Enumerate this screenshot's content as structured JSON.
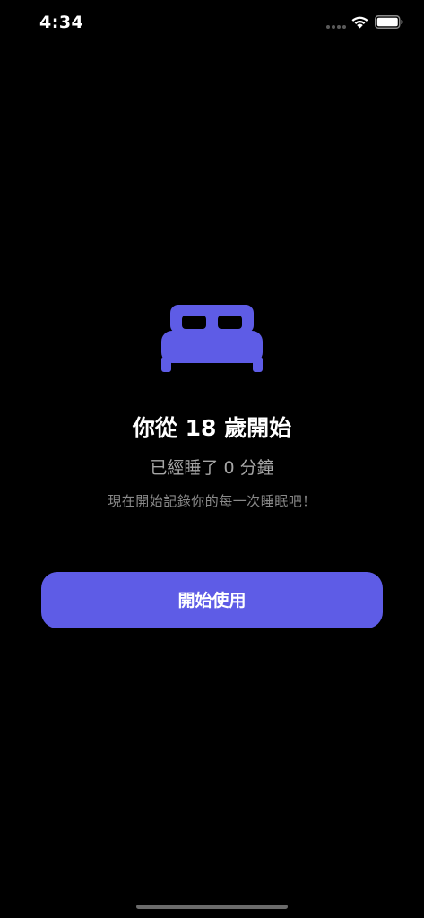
{
  "status_bar": {
    "time": "4:34",
    "icons": [
      "signal-dots-icon",
      "wifi-icon",
      "battery-icon"
    ]
  },
  "colors": {
    "background": "#000000",
    "accent": "#5e5ce6",
    "primary_text": "#ffffff",
    "secondary_text": "#a6a6a6",
    "hint_text": "#8a8a8a"
  },
  "main": {
    "icon": "bed-icon",
    "headline": "你從 18 歲開始",
    "subline": "已經睡了 0 分鐘",
    "hint": "現在開始記錄你的每一次睡眠吧！",
    "start_button_label": "開始使用"
  }
}
